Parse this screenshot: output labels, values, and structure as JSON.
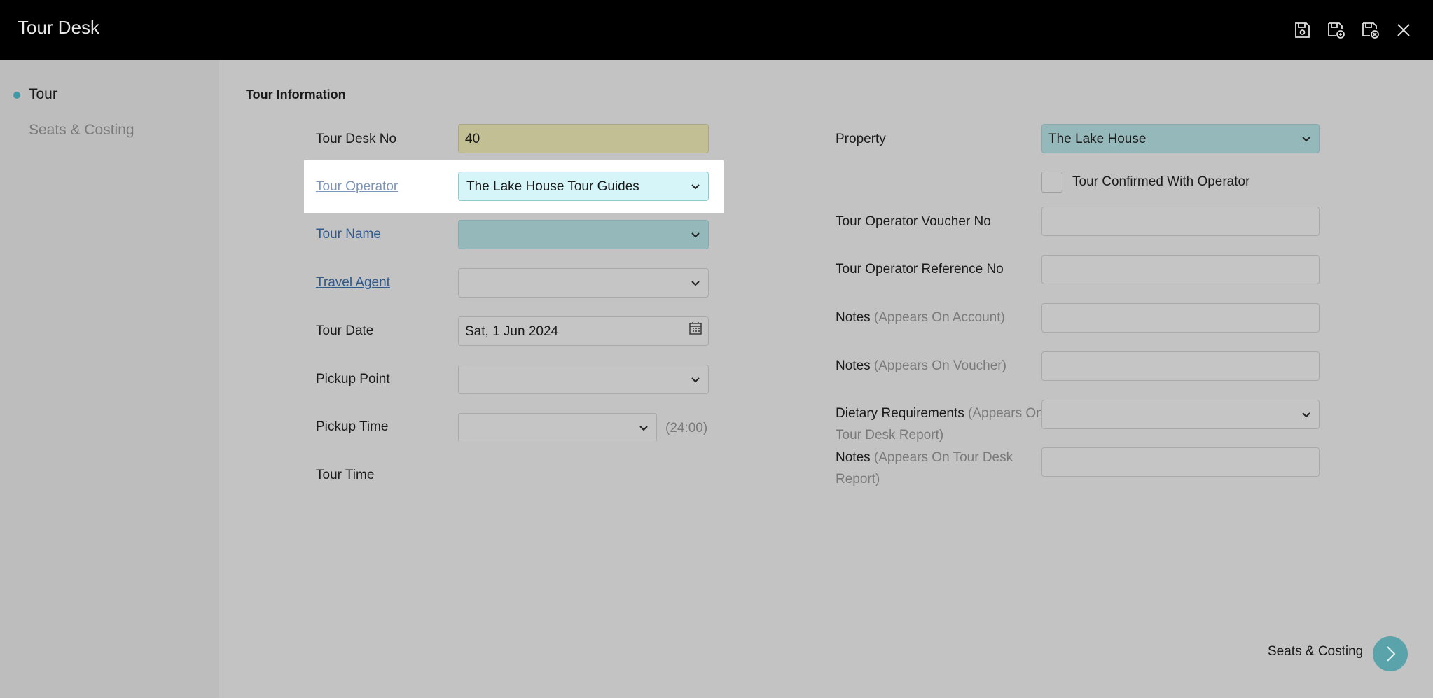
{
  "window": {
    "title": "Tour Desk"
  },
  "toolbar": {
    "icons": [
      "save-icon",
      "save-and-new-icon",
      "save-and-close-icon",
      "close-icon"
    ]
  },
  "sidebar": {
    "items": [
      {
        "label": "Tour",
        "active": true
      },
      {
        "label": "Seats & Costing",
        "active": false
      }
    ]
  },
  "form": {
    "section_title": "Tour Information",
    "tour_desk_no": {
      "label": "Tour Desk No",
      "value": "40"
    },
    "tour_operator": {
      "label": "Tour Operator",
      "value": "The Lake House Tour Guides"
    },
    "tour_name": {
      "label": "Tour Name",
      "value": ""
    },
    "travel_agent": {
      "label": "Travel Agent",
      "value": ""
    },
    "tour_date": {
      "label": "Tour Date",
      "value": "Sat, 1 Jun 2024"
    },
    "pickup_point": {
      "label": "Pickup Point",
      "value": ""
    },
    "pickup_time": {
      "label": "Pickup Time",
      "value": "",
      "hint": "(24:00)"
    },
    "tour_time": {
      "label": "Tour Time"
    },
    "property": {
      "label": "Property",
      "value": "The Lake House"
    },
    "confirmed": {
      "label": "Tour Confirmed With Operator",
      "checked": false
    },
    "voucher_no": {
      "label": "Tour Operator Voucher No",
      "value": ""
    },
    "reference_no": {
      "label": "Tour Operator Reference No",
      "value": ""
    },
    "notes_account": {
      "label": "Notes",
      "hint": "(Appears On Account)",
      "value": ""
    },
    "notes_voucher": {
      "label": "Notes",
      "hint": "(Appears On Voucher)",
      "value": ""
    },
    "dietary": {
      "label": "Dietary Requirements",
      "hint_line1": "(Appears On",
      "hint_line2": "Tour Desk Report)",
      "value": ""
    },
    "notes_report": {
      "label": "Notes",
      "hint_line1": "(Appears On Tour Desk",
      "hint_line2": "Report)",
      "value": ""
    }
  },
  "footer": {
    "next_label": "Seats & Costing"
  },
  "colors": {
    "accent": "#5ba3aa",
    "link": "#2f5a8c",
    "highlight": "#ffffff"
  }
}
